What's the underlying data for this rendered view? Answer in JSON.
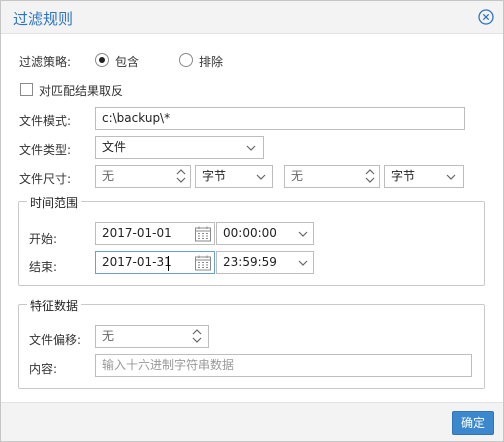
{
  "dialog": {
    "title": "过滤规则",
    "ok_label": "确定"
  },
  "policy": {
    "label": "过滤策略:",
    "options": [
      {
        "label": "包含",
        "checked": true
      },
      {
        "label": "排除",
        "checked": false
      }
    ]
  },
  "invert": {
    "label": "对匹配结果取反",
    "checked": false
  },
  "file_pattern": {
    "label": "文件模式:",
    "value": "c:\\backup\\*"
  },
  "file_type": {
    "label": "文件类型:",
    "value": "文件"
  },
  "file_size": {
    "label": "文件尺寸:",
    "min_value": "无",
    "min_unit": "字节",
    "max_value": "无",
    "max_unit": "字节"
  },
  "time_range": {
    "legend": "时间范围",
    "start_label": "开始:",
    "start_date": "2017-01-01",
    "start_time": "00:00:00",
    "end_label": "结束:",
    "end_date": "2017-01-31",
    "end_time": "23:59:59"
  },
  "signature": {
    "legend": "特征数据",
    "offset_label": "文件偏移:",
    "offset_value": "无",
    "content_label": "内容:",
    "content_placeholder": "输入十六进制字符串数据"
  },
  "colors": {
    "accent": "#2d74c4",
    "button": "#3c88cf"
  }
}
